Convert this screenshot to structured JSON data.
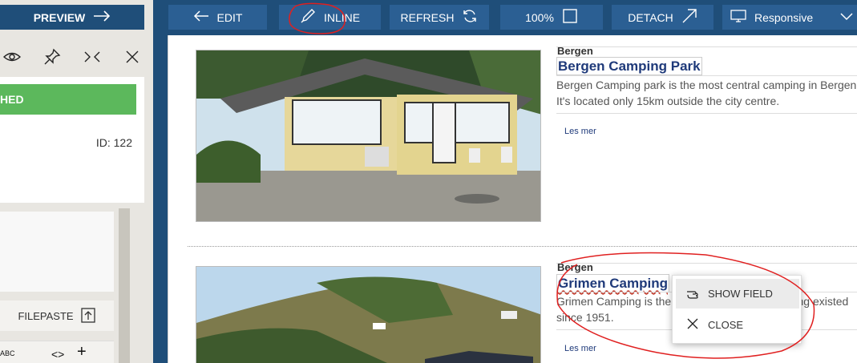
{
  "left_panel": {
    "preview_label": "PREVIEW",
    "status_label": "HED",
    "id_label": "ID: 122",
    "filepaste_label": "FILEPASTE",
    "tools": [
      "ABC",
      "<>",
      "+"
    ]
  },
  "toolbar": {
    "edit_label": "EDIT",
    "inline_label": "INLINE",
    "refresh_label": "REFRESH",
    "zoom_label": "100%",
    "detach_label": "DETACH",
    "responsive_label": "Responsive"
  },
  "items": [
    {
      "city": "Bergen",
      "title": "Bergen Camping Park",
      "description": "Bergen Camping park is the most central camping in Bergen It's located only 15km outside the city centre.",
      "more_label": "Les mer"
    },
    {
      "city": "Bergen",
      "title": "Grimen Camping",
      "description_start": "Grimen Camping is the",
      "description_end": ", having existed since 1951.",
      "more_label": "Les mer"
    }
  ],
  "context_menu": {
    "show_field_label": "SHOW FIELD",
    "close_label": "CLOSE"
  },
  "colors": {
    "toolbar_bg": "#1f4e79",
    "button_bg": "#2b5f93",
    "published_green": "#5cb85c",
    "title_blue": "#1f3a7a",
    "annotation_red": "#e02020"
  }
}
